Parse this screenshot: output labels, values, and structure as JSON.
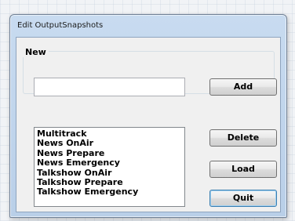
{
  "window": {
    "title": "Edit OutputSnapshots"
  },
  "new_group": {
    "label": "New",
    "input_value": "",
    "add_label": "Add"
  },
  "snapshots": {
    "items": [
      "Multitrack",
      "News OnAir",
      "News Prepare",
      "News Emergency",
      "Talkshow OnAir",
      "Talkshow Prepare",
      "Talkshow Emergency"
    ]
  },
  "actions": {
    "delete_label": "Delete",
    "load_label": "Load",
    "quit_label": "Quit"
  }
}
